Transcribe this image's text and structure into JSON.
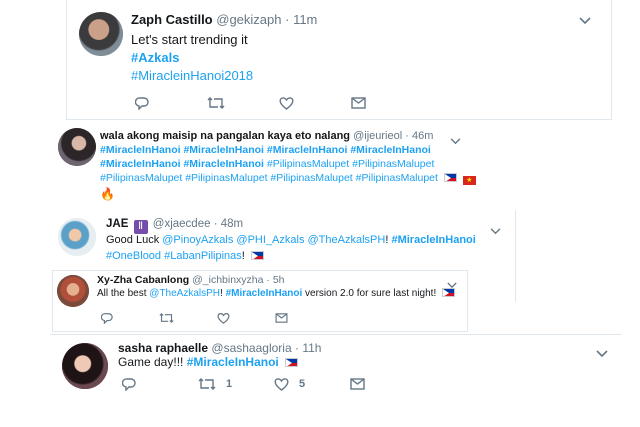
{
  "tweet1": {
    "name": "Zaph Castillo",
    "handle": "@gekizaph",
    "time": "· 11m",
    "text": "Let's start trending it",
    "tag1": "#Azkals",
    "tag2": "#MiracleinHanoi2018"
  },
  "tweet2": {
    "name": "wala akong maisip na pangalan kaya eto nalang",
    "handle": "@ijeurieol",
    "time": "· 46m",
    "line1": "#MiracleInHanoi #MiracleInHanoi #MiracleInHanoi #MiracleInHanoi",
    "line2a": "#MiracleInHanoi #MiracleInHanoi ",
    "line2b": "#PilipinasMalupet #PilipinasMalupet",
    "line3": "#PilipinasMalupet #PilipinasMalupet #PilipinasMalupet #PilipinasMalupet"
  },
  "tweet3": {
    "name": "JAE",
    "handle": "@xjaecdee",
    "time": "· 48m",
    "text_a": "Good Luck ",
    "mention1": "@PinoyAzkals",
    "mention2": "@PHI_Azkals",
    "mention3": "@TheAzkalsPH",
    "bang": "! ",
    "tag_main": "#MiracleInHanoi",
    "tag2": "#OneBlood",
    "tag3": "#LabanPilipinas",
    "excl": "!"
  },
  "tweet4": {
    "name": "Xy-Zha Cabanlong",
    "handle": "@_ichbinxyzha",
    "time": "· 5h",
    "text_a": "All the best ",
    "mention": "@TheAzkalsPH",
    "bang": "! ",
    "tag": "#MiracleInHanoi",
    "text_b": " version 2.0 for sure last night! "
  },
  "tweet5": {
    "name": "sasha raphaelle",
    "handle": "@sashaagloria",
    "time": "· 11h",
    "text": "Game day!!! ",
    "tag": "#MiracleInHanoi",
    "retweets": "1",
    "likes": "5"
  },
  "icons": [
    "reply-icon",
    "retweet-icon",
    "like-icon",
    "message-icon",
    "chevron-down-icon"
  ],
  "colors": {
    "link": "#1da1f2",
    "muted": "#657786",
    "text": "#14171a"
  }
}
